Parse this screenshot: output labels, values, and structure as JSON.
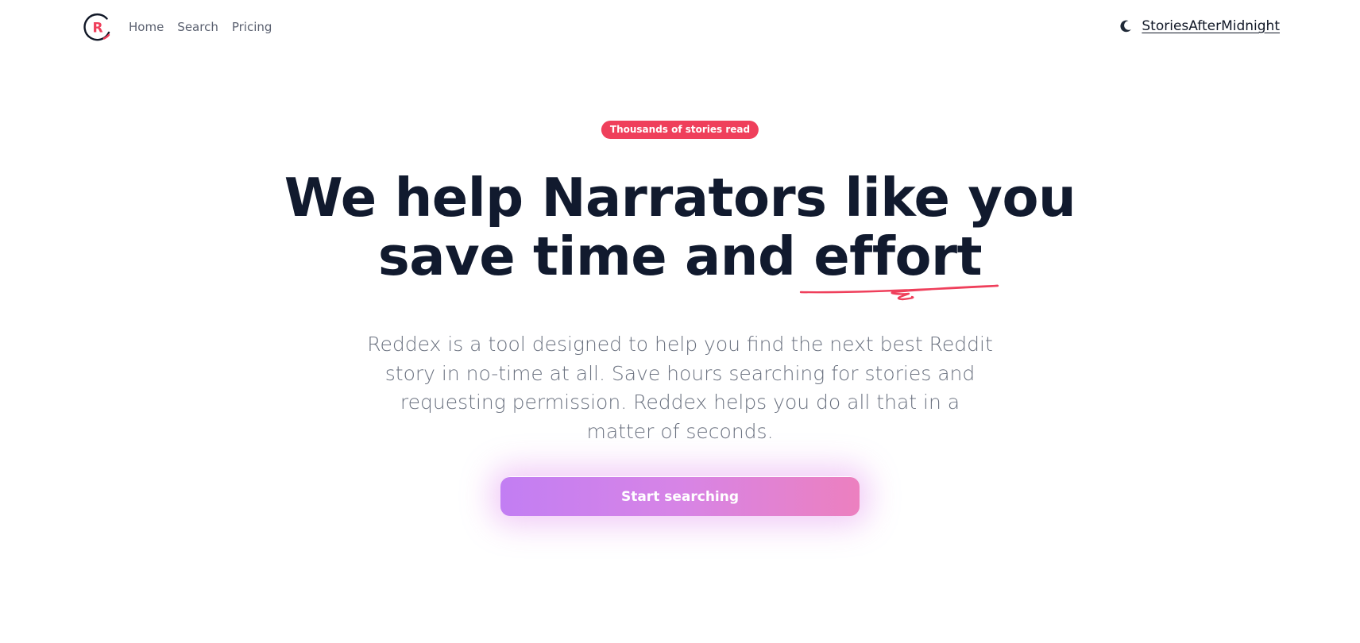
{
  "nav": {
    "logo_letter": "R",
    "links": [
      "Home",
      "Search",
      "Pricing"
    ],
    "theme_toggle_icon": "moon-icon",
    "user_name": "StoriesAfterMidnight"
  },
  "hero": {
    "badge": "Thousands of stories read",
    "headline_line1": "We help Narrators like you",
    "headline_line2_prefix": "save time and ",
    "headline_line2_highlight": "effort",
    "description": "Reddex is a tool designed to help you find the next best Reddit story in no-time at all. Save hours searching for stories and requesting permission. Reddex helps you do all that in a matter of seconds.",
    "cta_label": "Start searching"
  },
  "colors": {
    "accent": "#ef3f5b",
    "heading": "#111a2e",
    "body_text": "#6b7280",
    "cta_start": "#c27ef3",
    "cta_end": "#ec80bf"
  }
}
